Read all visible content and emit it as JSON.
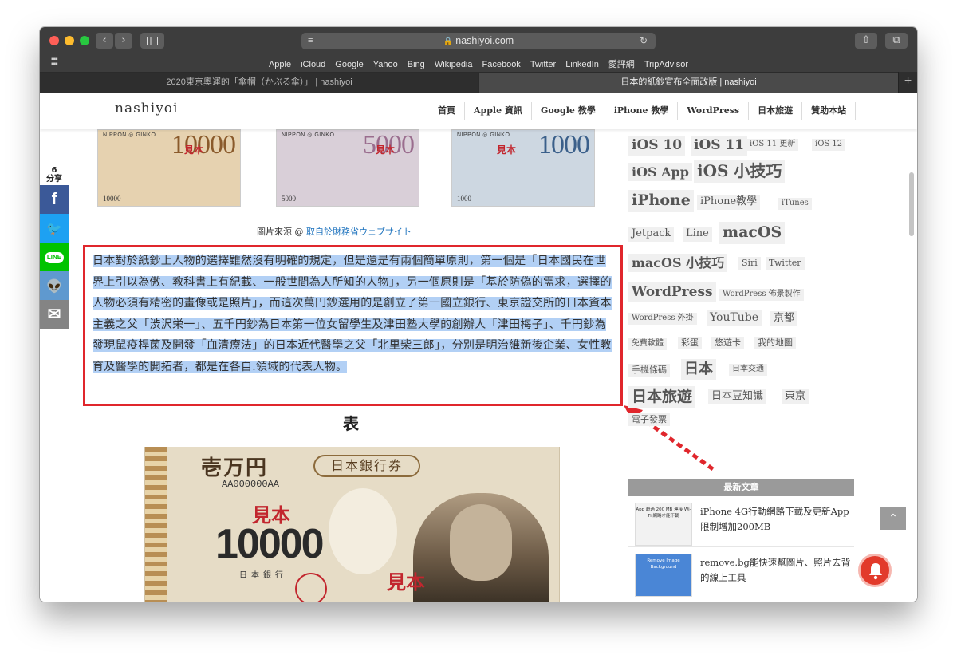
{
  "browser": {
    "url": "nashiyoi.com",
    "favorites": [
      "Apple",
      "iCloud",
      "Google",
      "Yahoo",
      "Bing",
      "Wikipedia",
      "Facebook",
      "Twitter",
      "LinkedIn",
      "愛評網",
      "TripAdvisor"
    ],
    "tabs": [
      {
        "label": "2020東京奧運的「傘帽（かぶる傘）」 | nashiyoi",
        "active": false
      },
      {
        "label": "日本的紙鈔宣布全面改版 | nashiyoi",
        "active": true
      }
    ],
    "colors": {
      "close": "#ff5f57",
      "minimize": "#febc2e",
      "zoom": "#28c840"
    }
  },
  "site": {
    "logo": "nashiyoi",
    "nav": [
      "首頁",
      "Apple 資訊",
      "Google 教學",
      "iPhone 教學",
      "WordPress",
      "日本旅遊",
      "贊助本站"
    ]
  },
  "social": {
    "count": "6",
    "count_label": "分享",
    "buttons": [
      {
        "name": "facebook",
        "glyph": "f",
        "color": "#3b5998"
      },
      {
        "name": "twitter",
        "glyph": "🐦",
        "color": "#1da1f2"
      },
      {
        "name": "line",
        "glyph": "LINE",
        "color": "#00c300"
      },
      {
        "name": "reddit",
        "glyph": "👽",
        "color": "#5f99cf"
      },
      {
        "name": "email",
        "glyph": "✉",
        "color": "#848484"
      }
    ]
  },
  "notes": [
    {
      "bank": "NIPPON ◎ GINKO",
      "value": "10000",
      "small": "10000",
      "mihon": "見本",
      "color": "#8a5a2b",
      "bg": "#e6d2b0"
    },
    {
      "bank": "NIPPON ◎ GINKO",
      "value": "5000",
      "small": "5000",
      "mihon": "見本",
      "color": "#9a6d8e",
      "bg": "#d9cfd8"
    },
    {
      "bank": "NIPPON ◎ GINKO",
      "value": "1000",
      "small": "1000",
      "mihon": "見本",
      "color": "#3a5f8a",
      "bg": "#cdd7e1"
    }
  ],
  "caption": {
    "prefix": "圖片來源 @",
    "link": "取自於財務省ウェブサイト"
  },
  "quote": "日本對於紙鈔上人物的選擇雖然沒有明確的規定，但是還是有兩個簡單原則，第一個是「日本國民在世界上引以為傲、教科書上有紀載、一般世間為人所知的人物」，另一個原則是「基於防偽的需求，選擇的人物必須有精密的畫像或是照片」，而這次萬円鈔選用的是創立了第一國立銀行、東京證交所的日本資本主義之父「渋沢栄一」、五千円鈔為日本第一位女留學生及津田塾大學的創辦人「津田梅子」、千円鈔為發現鼠疫桿菌及開發「血清療法」的日本近代醫學之父「北里柴三郎」，分別是明治維新後企業、女性教育及醫學的開拓者，都是在各自.領域的代表人物。",
  "face_title": "表",
  "bignote": {
    "oku": "壱万円",
    "nichigin": "日本銀行券",
    "serial": "AA000000AA",
    "mihon": "見本",
    "value": "10000",
    "bank_text": "日本銀行"
  },
  "tags": [
    "iOS 10",
    "iOS 11",
    "iOS 11 更新",
    "iOS 12",
    "iOS App",
    "iOS 小技巧",
    "iPhone",
    "iPhone教學",
    "iTunes",
    "Jetpack",
    "Line",
    "macOS",
    "macOS 小技巧",
    "Siri",
    "Twitter",
    "WordPress",
    "WordPress 佈景製作",
    "WordPress 外掛",
    "YouTube",
    "京都",
    "免費軟體",
    "彩蛋",
    "悠遊卡",
    "我的地圖",
    "手機條碼",
    "日本",
    "日本交通",
    "日本旅遊",
    "日本豆知識",
    "東京",
    "電子發票"
  ],
  "latest": {
    "title": "最新文章",
    "posts": [
      {
        "title": "iPhone 4G行動網路下載及更新App限制增加200MB",
        "thumb_text": "App 超過 200 MB 連接 Wi-Fi 網路才能下載"
      },
      {
        "title": "remove.bg能快速幫圖片、照片去背的線上工具",
        "thumb_text": "Remove Image Background"
      }
    ]
  },
  "scroll_top": "⌃"
}
